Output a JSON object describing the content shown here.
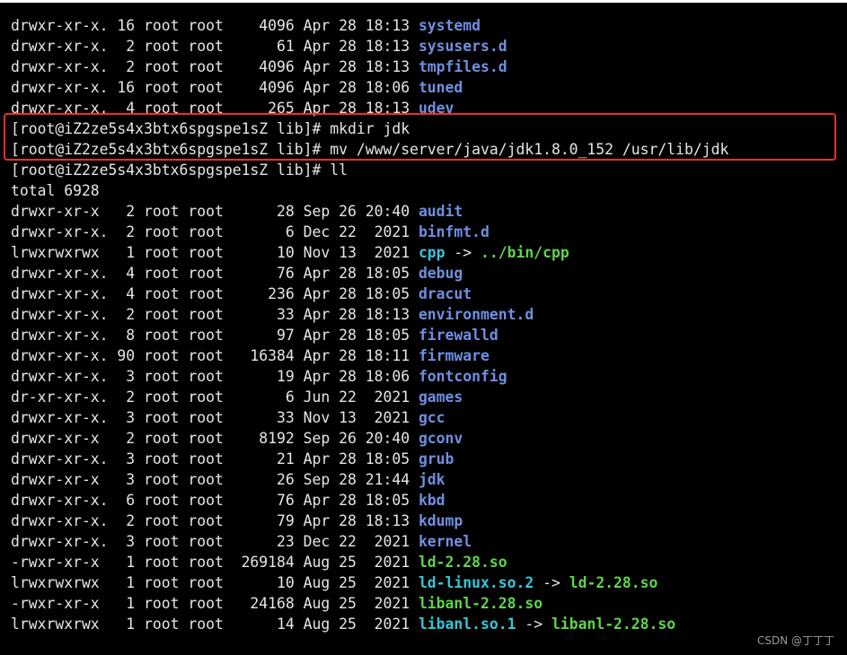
{
  "terminal": {
    "lines_before": [
      {
        "meta": "drwxr-xr-x. 16 root root    4096 Apr 28 18:13 ",
        "name": "systemd",
        "type": "dir"
      },
      {
        "meta": "drwxr-xr-x.  2 root root      61 Apr 28 18:13 ",
        "name": "sysusers.d",
        "type": "dir"
      },
      {
        "meta": "drwxr-xr-x.  2 root root    4096 Apr 28 18:13 ",
        "name": "tmpfiles.d",
        "type": "dir"
      },
      {
        "meta": "drwxr-xr-x. 16 root root    4096 Apr 28 18:06 ",
        "name": "tuned",
        "type": "dir"
      },
      {
        "meta": "drwxr-xr-x.  4 root root     265 Apr 28 18:13 ",
        "name": "udev",
        "type": "dir"
      }
    ],
    "commands": [
      "[root@iZ2ze5s4x3btx6spgspe1sZ lib]# mkdir jdk",
      "[root@iZ2ze5s4x3btx6spgspe1sZ lib]# mv /www/server/java/jdk1.8.0_152 /usr/lib/jdk",
      "[root@iZ2ze5s4x3btx6spgspe1sZ lib]# ll"
    ],
    "total": "total 6928",
    "listing": [
      {
        "meta": "drwxr-xr-x   2 root root      28 Sep 26 20:40 ",
        "name": "audit",
        "type": "dir"
      },
      {
        "meta": "drwxr-xr-x.  2 root root       6 Dec 22  2021 ",
        "name": "binfmt.d",
        "type": "dir"
      },
      {
        "meta": "lrwxrwxrwx   1 root root      10 Nov 13  2021 ",
        "name": "cpp",
        "type": "link",
        "target": "../bin/cpp",
        "target_type": "exec"
      },
      {
        "meta": "drwxr-xr-x.  4 root root      76 Apr 28 18:05 ",
        "name": "debug",
        "type": "dir"
      },
      {
        "meta": "drwxr-xr-x.  4 root root     236 Apr 28 18:05 ",
        "name": "dracut",
        "type": "dir"
      },
      {
        "meta": "drwxr-xr-x.  2 root root      33 Apr 28 18:13 ",
        "name": "environment.d",
        "type": "dir"
      },
      {
        "meta": "drwxr-xr-x.  8 root root      97 Apr 28 18:05 ",
        "name": "firewalld",
        "type": "dir"
      },
      {
        "meta": "drwxr-xr-x. 90 root root   16384 Apr 28 18:11 ",
        "name": "firmware",
        "type": "dir"
      },
      {
        "meta": "drwxr-xr-x.  3 root root      19 Apr 28 18:06 ",
        "name": "fontconfig",
        "type": "dir"
      },
      {
        "meta": "dr-xr-xr-x.  2 root root       6 Jun 22  2021 ",
        "name": "games",
        "type": "dir"
      },
      {
        "meta": "drwxr-xr-x.  3 root root      33 Nov 13  2021 ",
        "name": "gcc",
        "type": "dir"
      },
      {
        "meta": "drwxr-xr-x   2 root root    8192 Sep 26 20:40 ",
        "name": "gconv",
        "type": "dir"
      },
      {
        "meta": "drwxr-xr-x.  3 root root      21 Apr 28 18:05 ",
        "name": "grub",
        "type": "dir"
      },
      {
        "meta": "drwxr-xr-x   3 root root      26 Sep 28 21:44 ",
        "name": "jdk",
        "type": "dir"
      },
      {
        "meta": "drwxr-xr-x.  6 root root      76 Apr 28 18:05 ",
        "name": "kbd",
        "type": "dir"
      },
      {
        "meta": "drwxr-xr-x.  2 root root      79 Apr 28 18:13 ",
        "name": "kdump",
        "type": "dir"
      },
      {
        "meta": "drwxr-xr-x.  3 root root      23 Dec 22  2021 ",
        "name": "kernel",
        "type": "dir"
      },
      {
        "meta": "-rwxr-xr-x   1 root root  269184 Aug 25  2021 ",
        "name": "ld-2.28.so",
        "type": "exec"
      },
      {
        "meta": "lrwxrwxrwx   1 root root      10 Aug 25  2021 ",
        "name": "ld-linux.so.2",
        "type": "link",
        "target": "ld-2.28.so",
        "target_type": "exec"
      },
      {
        "meta": "-rwxr-xr-x   1 root root   24168 Aug 25  2021 ",
        "name": "libanl-2.28.so",
        "type": "exec"
      },
      {
        "meta": "lrwxrwxrwx   1 root root      14 Aug 25  2021 ",
        "name": "libanl.so.1",
        "type": "link",
        "target": "libanl-2.28.so",
        "target_type": "exec"
      }
    ]
  },
  "arrow": " -> ",
  "watermark": "CSDN @丁丁丁",
  "colors": {
    "dir": "#6f8fe0",
    "link": "#35c6d9",
    "exec": "#5fd34a",
    "text": "#e6e6e6",
    "highlight": "#e8302a"
  }
}
